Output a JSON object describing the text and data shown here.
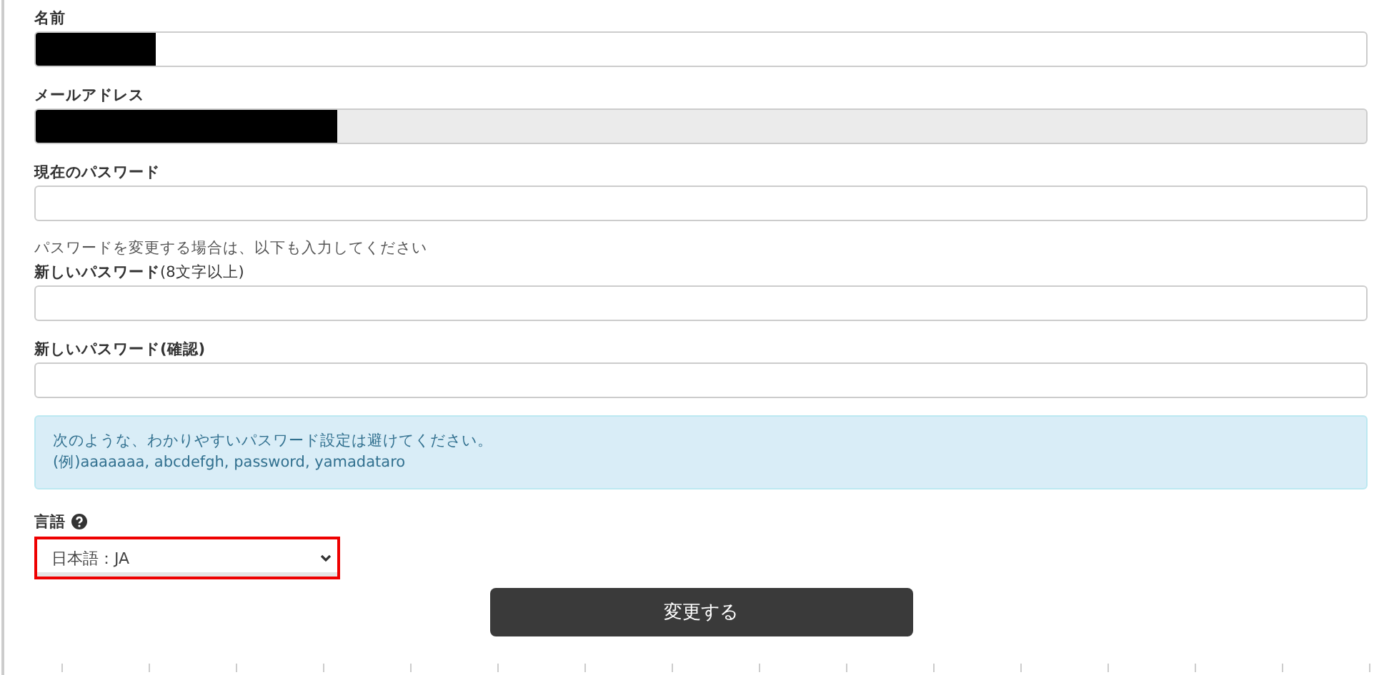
{
  "fields": [
    {
      "label": "名前",
      "redacted": true,
      "disabled": false
    },
    {
      "label": "メールアドレス",
      "redacted": true,
      "disabled": true
    },
    {
      "label": "現在のパスワード",
      "redacted": false,
      "disabled": false
    },
    {
      "hint": "パスワードを変更する場合は、以下も入力してください",
      "label": "新しいパスワード",
      "note": "(8文字以上)",
      "redacted": false,
      "disabled": false
    },
    {
      "label": "新しいパスワード(確認)",
      "redacted": false,
      "disabled": false
    }
  ],
  "alert": {
    "lines": [
      "次のような、わかりやすいパスワード設定は避けてください。",
      "(例)aaaaaaa, abcdefgh, password, yamadataro"
    ]
  },
  "language": {
    "label": "言語",
    "value": "日本語：JA",
    "highlighted": true
  },
  "submit": "変更する"
}
